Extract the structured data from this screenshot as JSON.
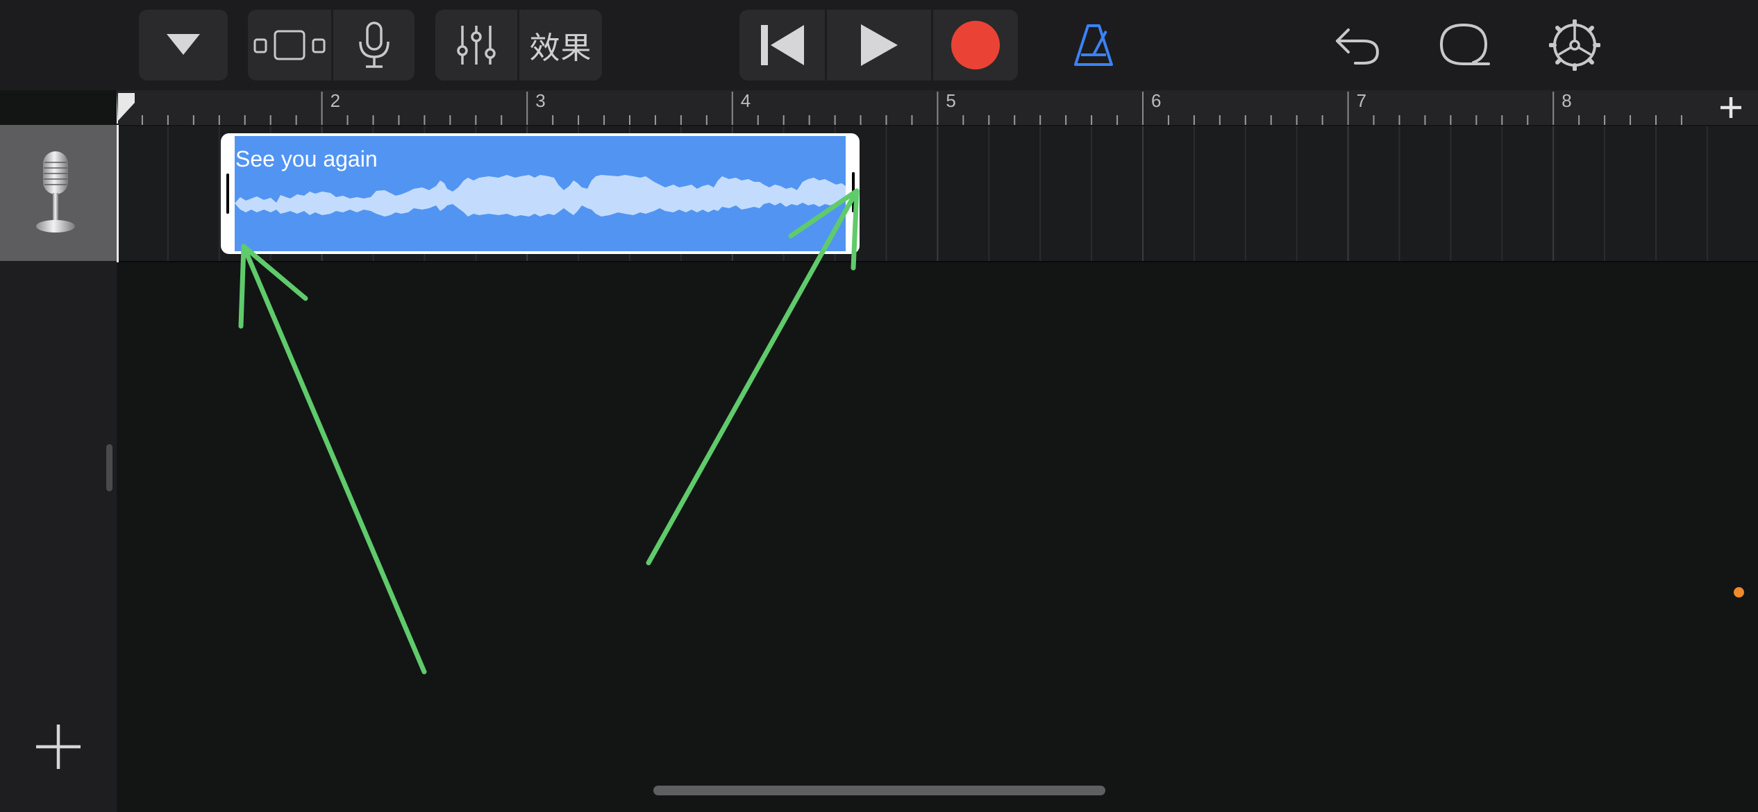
{
  "toolbar": {
    "effects_label": "效果",
    "icons": [
      "dropdown-arrow-icon",
      "tracks-view-icon",
      "microphone-icon",
      "mixer-sliders-icon",
      "go-to-beginning-icon",
      "play-icon",
      "record-icon",
      "metronome-icon",
      "undo-icon",
      "loop-icon",
      "settings-gear-icon"
    ]
  },
  "ruler": {
    "bar_numbers": [
      "2",
      "3",
      "4",
      "5",
      "6",
      "7",
      "8"
    ]
  },
  "track": {
    "instrument_icon": "microphone-icon",
    "region": {
      "title": "See you again"
    }
  },
  "colors": {
    "background": "#131515",
    "toolbar": "#1c1c1e",
    "region_blue": "#5294f2",
    "waveform": "#c3dcfd",
    "record_red": "#ea4335",
    "metronome_blue": "#3b82f6",
    "annotation_green": "#5fcb6b",
    "indicator_orange": "#f08a2a"
  }
}
